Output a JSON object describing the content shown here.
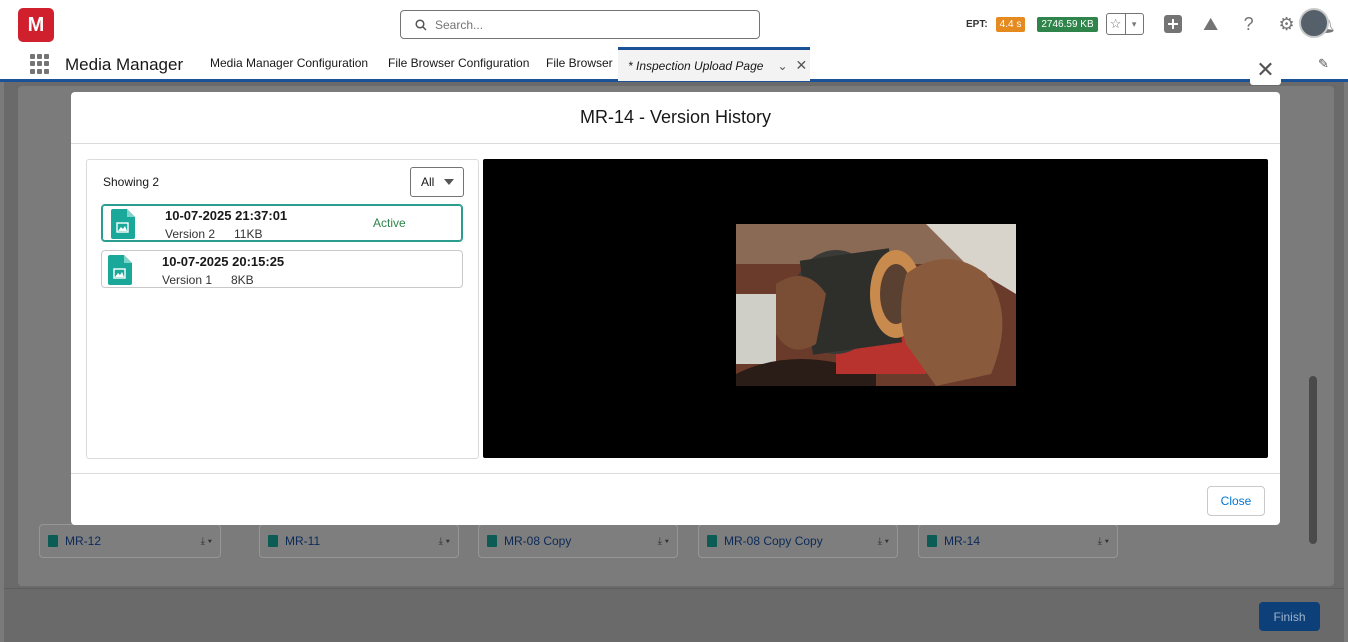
{
  "header": {
    "logo_text": "M",
    "search_placeholder": "Search...",
    "ept_label": "EPT:",
    "ept_value": "4.4 s",
    "kb_value": "2746.59 KB"
  },
  "nav": {
    "app_name": "Media Manager",
    "tabs": [
      {
        "label": "Media Manager Configuration"
      },
      {
        "label": "File Browser Configuration"
      },
      {
        "label": "File Browser"
      },
      {
        "label": "* Inspection Upload Page"
      }
    ]
  },
  "background": {
    "cards": [
      {
        "label": "MR-12"
      },
      {
        "label": "MR-11"
      },
      {
        "label": "MR-08 Copy"
      },
      {
        "label": "MR-08 Copy Copy"
      },
      {
        "label": "MR-14"
      }
    ],
    "finish_label": "Finish"
  },
  "modal": {
    "title": "MR-14 - Version History",
    "showing_text": "Showing 2",
    "filter_value": "All",
    "versions": [
      {
        "date": "10-07-2025 21:37:01",
        "version": "Version 2",
        "size": "11KB",
        "status": "Active"
      },
      {
        "date": "10-07-2025 20:15:25",
        "version": "Version 1",
        "size": "8KB",
        "status": ""
      }
    ],
    "close_label": "Close"
  },
  "colors": {
    "brand": "#d0202e",
    "accent": "#0176d3",
    "active_status": "#2e844a",
    "file_icon": "#1aa89a"
  }
}
